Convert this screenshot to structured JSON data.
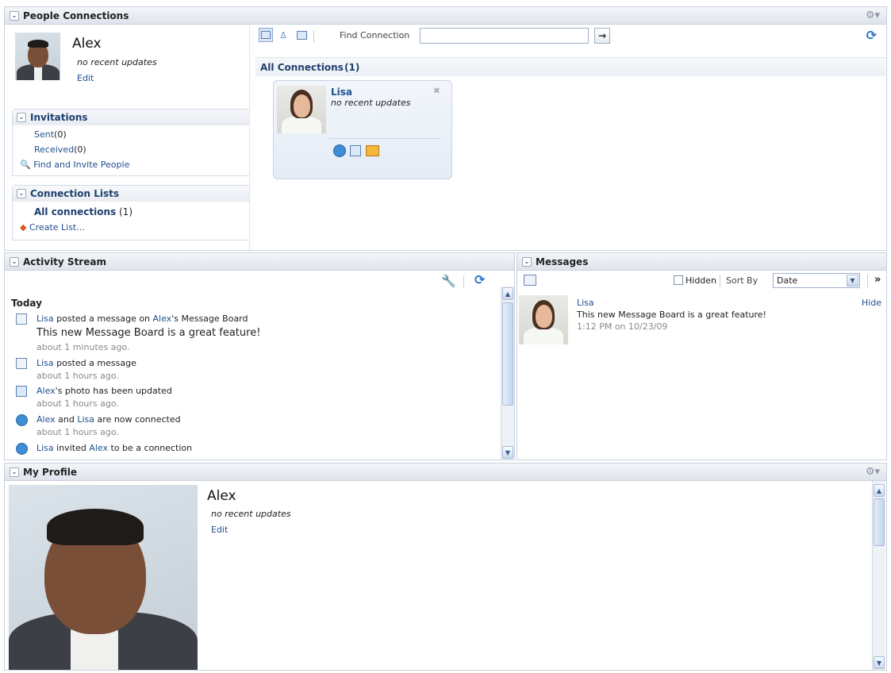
{
  "people_connections": {
    "title": "People Connections",
    "user": {
      "name": "Alex",
      "status": "no recent updates",
      "edit": "Edit"
    },
    "invitations": {
      "title": "Invitations",
      "sent_label": "Sent",
      "sent_count": "(0)",
      "received_label": "Received",
      "received_count": "(0)",
      "find_invite": "Find and Invite People"
    },
    "connection_lists": {
      "title": "Connection Lists",
      "all_label": "All connections",
      "all_count": "(1)",
      "create": "Create List..."
    },
    "toolbar": {
      "find_label": "Find Connection",
      "find_value": "",
      "go_arrow": "→"
    },
    "all_connections": {
      "label": "All Connections",
      "count": "(1)"
    },
    "card": {
      "name": "Lisa",
      "status": "no recent updates"
    }
  },
  "activity_stream": {
    "title": "Activity Stream",
    "today": "Today",
    "items": [
      {
        "actor": "Lisa",
        "verb": "posted a message on",
        "target": "Alex",
        "suffix": "'s Message Board",
        "message": "This new Message Board is a great feature!",
        "time": "about 1 minutes ago."
      },
      {
        "actor": "Lisa",
        "verb": "posted a message",
        "time": "about 1 hours ago."
      },
      {
        "actor": "Alex",
        "verb": "'s photo has been updated",
        "time": "about 1 hours ago."
      },
      {
        "actor": "Alex",
        "verb": "and",
        "target": "Lisa",
        "suffix": "are now connected",
        "time": "about 1 hours ago."
      },
      {
        "actor": "Lisa",
        "verb": "invited",
        "target": "Alex",
        "suffix": "to be a connection"
      }
    ]
  },
  "messages": {
    "title": "Messages",
    "hidden_label": "Hidden",
    "sort_by": "Sort By",
    "sort_value": "Date",
    "more": "»",
    "item": {
      "from": "Lisa",
      "text": "This new Message Board is a great feature!",
      "time": "1:12 PM on 10/23/09",
      "hide": "Hide"
    }
  },
  "my_profile": {
    "title": "My Profile",
    "name": "Alex",
    "status": "no recent updates",
    "edit": "Edit"
  },
  "icons": {
    "collapse": "chevron-down-icon",
    "gear": "gear-icon",
    "refresh": "refresh-icon"
  }
}
